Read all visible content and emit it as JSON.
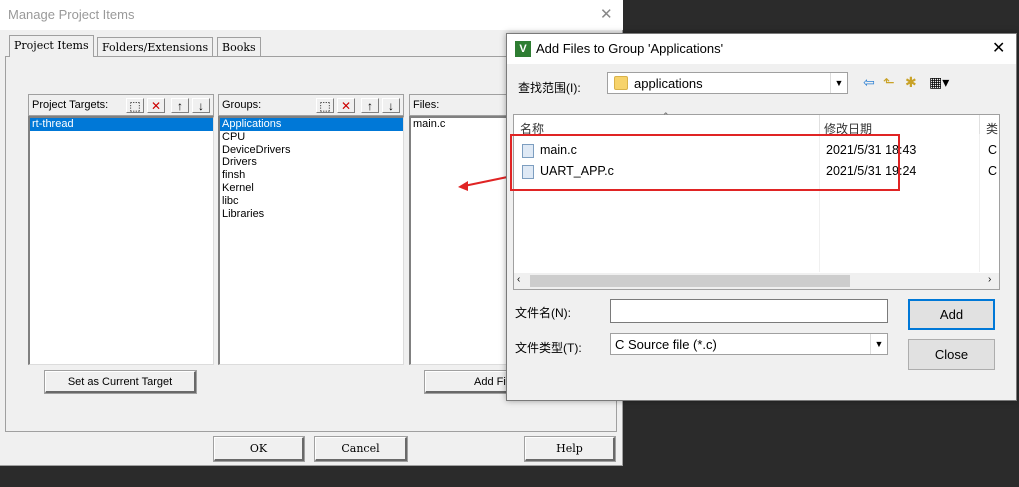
{
  "manage_window": {
    "title": "Manage Project Items",
    "close_glyph": "✕",
    "tabs": [
      "Project Items",
      "Folders/Extensions",
      "Books"
    ],
    "project_targets": {
      "label": "Project Targets:",
      "items": [
        "rt-thread"
      ]
    },
    "groups": {
      "label": "Groups:",
      "items": [
        "Applications",
        "CPU",
        "DeviceDrivers",
        "Drivers",
        "finsh",
        "Kernel",
        "libc",
        "Libraries"
      ]
    },
    "files": {
      "label": "Files:",
      "items": [
        "main.c"
      ]
    },
    "toolbar_glyphs": {
      "new": "⬚",
      "delete": "✕",
      "up": "↑",
      "down": "↓"
    },
    "set_target_button": "Set as Current Target",
    "add_files_button": "Add Fil",
    "ok_button": "OK",
    "cancel_button": "Cancel",
    "help_button": "Help"
  },
  "add_files_dialog": {
    "title": "Add Files to Group 'Applications'",
    "icon_letter": "V",
    "close_glyph": "✕",
    "look_in_label": "查找范围(I):",
    "look_in_value": "applications",
    "columns": {
      "name": "名称",
      "modified": "修改日期",
      "type": "类"
    },
    "files": [
      {
        "name": "main.c",
        "modified": "2021/5/31 18:43",
        "type": "C"
      },
      {
        "name": "UART_APP.c",
        "modified": "2021/5/31 19:24",
        "type": "C"
      }
    ],
    "filename_label": "文件名(N):",
    "filename_value": "",
    "filetype_label": "文件类型(T):",
    "filetype_value": "C Source file (*.c)",
    "add_button": "Add",
    "close_button": "Close"
  },
  "colors": {
    "selection": "#0078d7",
    "annotation_red": "#e02424",
    "desktop": "#2b2b2b"
  }
}
